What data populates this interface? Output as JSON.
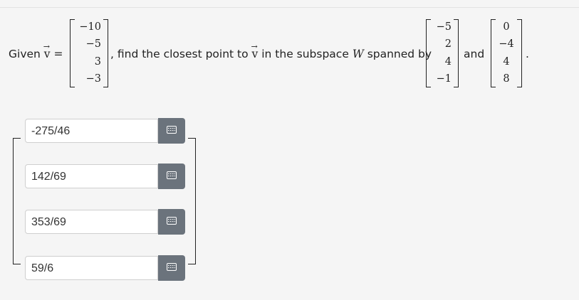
{
  "question": {
    "given_label": "Given",
    "v_symbol": "v",
    "v_arrow": "→",
    "equals": "=",
    "mid_text_before": ", find the closest point to",
    "mid_text_after": "in the subspace",
    "W_symbol": "W",
    "spanned_by": "spanned by",
    "and_label": "and",
    "period": ".",
    "v_vector": [
      "−10",
      "−5",
      "3",
      "−3"
    ],
    "w1_vector": [
      "−5",
      "2",
      "4",
      "−1"
    ],
    "w2_vector": [
      "0",
      "−4",
      "4",
      "8"
    ]
  },
  "answers": [
    {
      "value": "-275/46"
    },
    {
      "value": "142/69"
    },
    {
      "value": "353/69"
    },
    {
      "value": "59/6"
    }
  ],
  "icons": {
    "keyboard_button": "keyboard-icon"
  },
  "colors": {
    "button_bg": "#6b737c",
    "page_bg": "#f5f5f5"
  }
}
